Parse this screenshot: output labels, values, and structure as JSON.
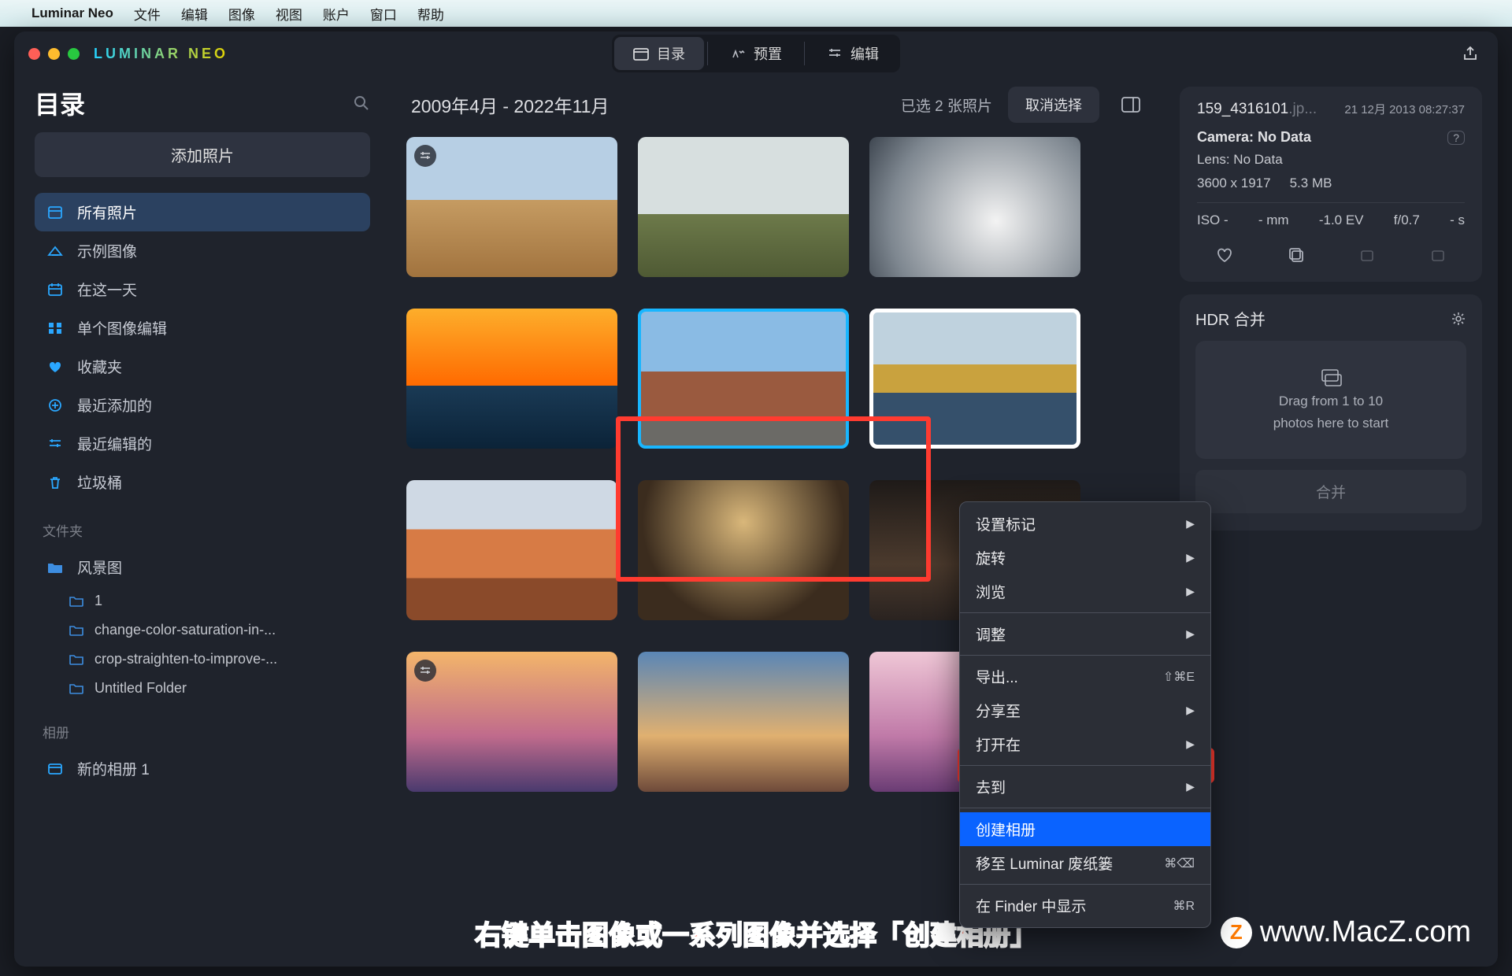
{
  "menubar": {
    "app": "Luminar Neo",
    "items": [
      "文件",
      "编辑",
      "图像",
      "视图",
      "账户",
      "窗口",
      "帮助"
    ]
  },
  "app_logo": "LUMINAR NEO",
  "tabs": {
    "catalog": "目录",
    "presets": "预置",
    "edit": "编辑"
  },
  "sidebar": {
    "title": "目录",
    "add_button": "添加照片",
    "items": [
      {
        "icon": "photos-icon",
        "label": "所有照片",
        "active": true
      },
      {
        "icon": "sample-icon",
        "label": "示例图像"
      },
      {
        "icon": "calendar-icon",
        "label": "在这一天"
      },
      {
        "icon": "single-icon",
        "label": "单个图像编辑"
      },
      {
        "icon": "heart-icon",
        "label": "收藏夹"
      },
      {
        "icon": "recent-add-icon",
        "label": "最近添加的"
      },
      {
        "icon": "recent-edit-icon",
        "label": "最近编辑的"
      },
      {
        "icon": "trash-icon",
        "label": "垃圾桶"
      }
    ],
    "folders_label": "文件夹",
    "folders_root": "风景图",
    "folders": [
      "1",
      "change-color-saturation-in-...",
      "crop-straighten-to-improve-...",
      "Untitled Folder"
    ],
    "albums_label": "相册",
    "albums": [
      "新的相册 1"
    ]
  },
  "main": {
    "date_range": "2009年4月 - 2022年11月",
    "selected_text": "已选 2 张照片",
    "deselect": "取消选择"
  },
  "info": {
    "filename_base": "159_4316101",
    "filename_ext": ".jp...",
    "datetime": "21 12月 2013 08:27:37",
    "camera_label": "Camera: No Data",
    "lens_label": "Lens: No Data",
    "dimensions": "3600 x 1917",
    "size": "5.3 MB",
    "iso": "ISO -",
    "mm": "- mm",
    "ev": "-1.0 EV",
    "f": "f/0.7",
    "s": "- s"
  },
  "hdr": {
    "title": "HDR 合并",
    "hint1": "Drag from 1 to 10",
    "hint2": "photos here to start",
    "merge_btn": "合并"
  },
  "context_menu": {
    "items": [
      {
        "label": "设置标记",
        "sub": true
      },
      {
        "label": "旋转",
        "sub": true
      },
      {
        "label": "浏览",
        "sub": true
      },
      {
        "sep": true
      },
      {
        "label": "调整",
        "sub": true
      },
      {
        "sep": true
      },
      {
        "label": "导出...",
        "shortcut": "⇧⌘E"
      },
      {
        "label": "分享至",
        "sub": true
      },
      {
        "label": "打开在",
        "sub": true
      },
      {
        "sep": true
      },
      {
        "label": "去到",
        "sub": true
      },
      {
        "sep": true
      },
      {
        "label": "创建相册",
        "highlight": true
      },
      {
        "label": "移至 Luminar 废纸篓",
        "shortcut": "⌘⌫"
      },
      {
        "sep": true
      },
      {
        "label": "在 Finder 中显示",
        "shortcut": "⌘R"
      }
    ]
  },
  "caption": "右键单击图像或一系列图像并选择「创建相册」",
  "watermark": "www.MacZ.com",
  "colors": {
    "accent": "#0a63ff",
    "highlight_border": "#ff3b30"
  }
}
